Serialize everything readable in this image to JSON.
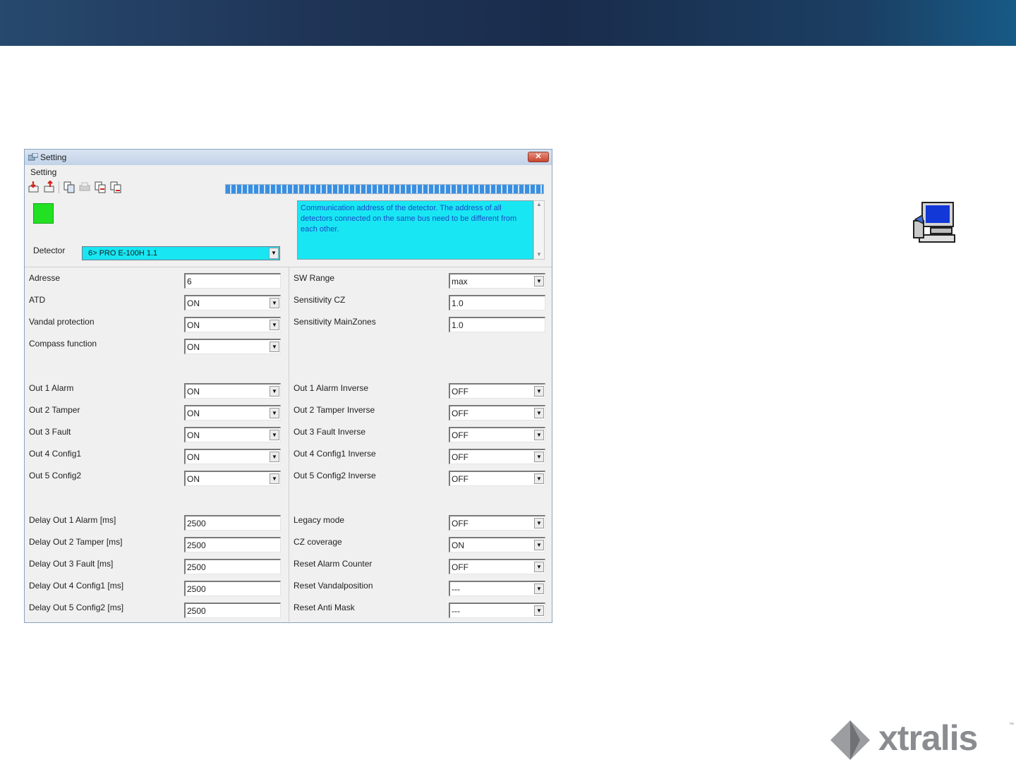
{
  "window": {
    "title": "Setting",
    "menu": [
      "Setting"
    ],
    "toolbar_icons": [
      "read-from-device-icon",
      "write-to-device-icon",
      "copy-icon",
      "print-icon",
      "export-icon",
      "import-icon"
    ],
    "progress_percent": 100
  },
  "detector": {
    "label": "Detector",
    "value": "6> PRO E-100H 1.1",
    "status_color": "#22e022"
  },
  "description": "Communication address of the detector. The address of all detectors connected on the same bus need to be different from each other.",
  "left_fields": [
    {
      "label": "Adresse",
      "value": "6",
      "type": "text"
    },
    {
      "label": "ATD",
      "value": "ON",
      "type": "select"
    },
    {
      "label": "Vandal protection",
      "value": "ON",
      "type": "select"
    },
    {
      "label": "Compass function",
      "value": "ON",
      "type": "select"
    },
    {
      "label": "Out 1 Alarm",
      "value": "ON",
      "type": "select"
    },
    {
      "label": "Out 2 Tamper",
      "value": "ON",
      "type": "select"
    },
    {
      "label": "Out 3 Fault",
      "value": "ON",
      "type": "select"
    },
    {
      "label": "Out 4 Config1",
      "value": "ON",
      "type": "select"
    },
    {
      "label": "Out 5 Config2",
      "value": "ON",
      "type": "select"
    },
    {
      "label": "Delay Out 1 Alarm [ms]",
      "value": "2500",
      "type": "text"
    },
    {
      "label": "Delay Out 2 Tamper [ms]",
      "value": "2500",
      "type": "text"
    },
    {
      "label": "Delay Out 3 Fault [ms]",
      "value": "2500",
      "type": "text"
    },
    {
      "label": "Delay Out 4 Config1 [ms]",
      "value": "2500",
      "type": "text"
    },
    {
      "label": "Delay Out 5 Config2 [ms]",
      "value": "2500",
      "type": "text"
    }
  ],
  "right_fields": [
    {
      "label": "SW Range",
      "value": "max",
      "type": "select"
    },
    {
      "label": "Sensitivity CZ",
      "value": "1.0",
      "type": "text"
    },
    {
      "label": "Sensitivity MainZones",
      "value": "1.0",
      "type": "text"
    },
    {
      "label": "Out 1 Alarm Inverse",
      "value": "OFF",
      "type": "select"
    },
    {
      "label": "Out 2 Tamper Inverse",
      "value": "OFF",
      "type": "select"
    },
    {
      "label": "Out 3 Fault Inverse",
      "value": "OFF",
      "type": "select"
    },
    {
      "label": "Out 4 Config1 Inverse",
      "value": "OFF",
      "type": "select"
    },
    {
      "label": "Out 5 Config2 Inverse",
      "value": "OFF",
      "type": "select"
    },
    {
      "label": "Legacy mode",
      "value": "OFF",
      "type": "select"
    },
    {
      "label": "CZ coverage",
      "value": "ON",
      "type": "select"
    },
    {
      "label": "Reset Alarm Counter",
      "value": "OFF",
      "type": "select"
    },
    {
      "label": "Reset Vandalposition",
      "value": "---",
      "type": "select"
    },
    {
      "label": "Reset Anti Mask",
      "value": "---",
      "type": "select"
    }
  ],
  "brand": {
    "name": "xtralis",
    "trademark": "™",
    "color": "#8a8c8f"
  }
}
